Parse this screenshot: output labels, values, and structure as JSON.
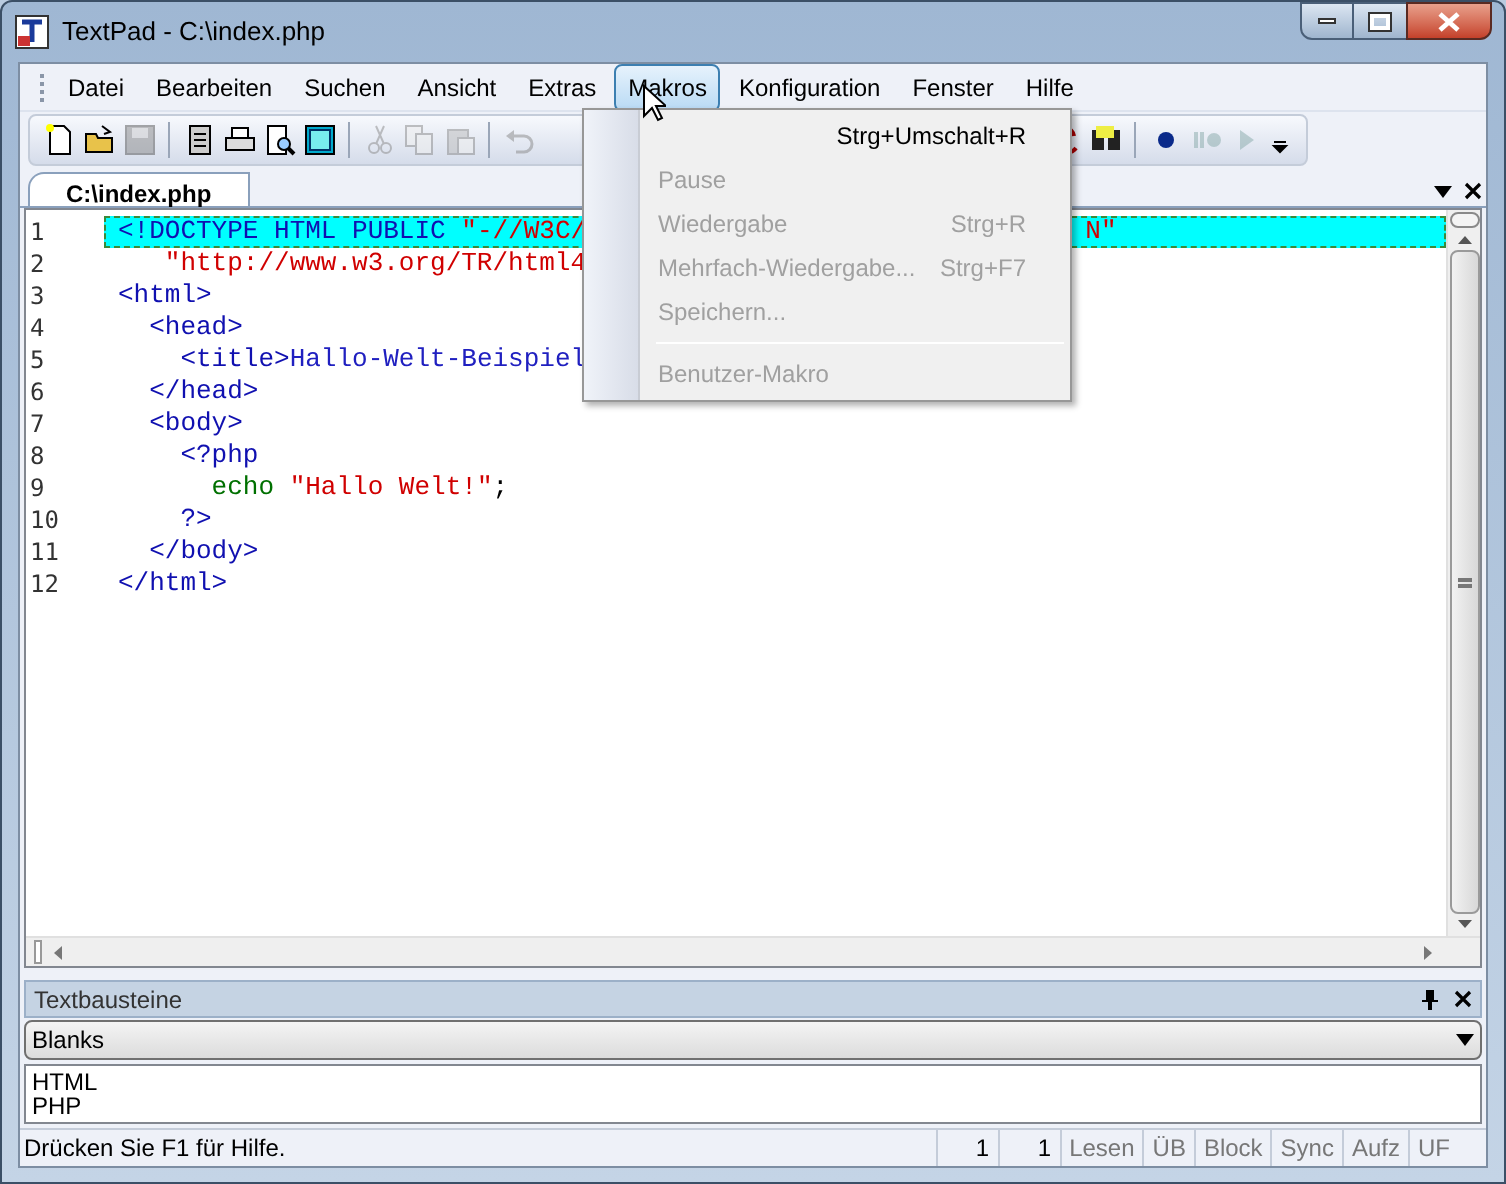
{
  "window": {
    "title": "TextPad - C:\\index.php"
  },
  "menu_bar": [
    {
      "label": "Datei",
      "selected": false
    },
    {
      "label": "Bearbeiten",
      "selected": false
    },
    {
      "label": "Suchen",
      "selected": false
    },
    {
      "label": "Ansicht",
      "selected": false
    },
    {
      "label": "Extras",
      "selected": false
    },
    {
      "label": "Makros",
      "selected": true
    },
    {
      "label": "Konfiguration",
      "selected": false
    },
    {
      "label": "Fenster",
      "selected": false
    },
    {
      "label": "Hilfe",
      "selected": false
    }
  ],
  "toolbar": [
    {
      "kind": "new",
      "disabled": false
    },
    {
      "kind": "open",
      "disabled": false
    },
    {
      "kind": "save",
      "disabled": true
    },
    {
      "kind": "sep"
    },
    {
      "kind": "docs",
      "disabled": false
    },
    {
      "kind": "print",
      "disabled": false
    },
    {
      "kind": "preview",
      "disabled": false
    },
    {
      "kind": "screen",
      "disabled": false
    },
    {
      "kind": "sep"
    },
    {
      "kind": "cut",
      "disabled": true
    },
    {
      "kind": "copy",
      "disabled": true
    },
    {
      "kind": "paste",
      "disabled": true
    },
    {
      "kind": "sep"
    },
    {
      "kind": "undo",
      "disabled": true
    },
    {
      "kind": "gap"
    },
    {
      "kind": "replace",
      "disabled": false
    },
    {
      "kind": "find",
      "disabled": false
    },
    {
      "kind": "sep"
    },
    {
      "kind": "record",
      "disabled": false
    },
    {
      "kind": "pause",
      "disabled": true
    },
    {
      "kind": "play",
      "disabled": true
    },
    {
      "kind": "more",
      "disabled": false
    }
  ],
  "document_tabs": [
    {
      "label": "C:\\index.php",
      "selected": true
    }
  ],
  "editor": {
    "lines": [
      {
        "number": "1",
        "selected": true,
        "tokens": [
          {
            "kind": "tag",
            "text": "<!DOCTYPE HTML PUBLIC "
          },
          {
            "kind": "string",
            "text": "\"-//W3C/"
          }
        ],
        "tail": [
          {
            "kind": "string",
            "text": "N\""
          }
        ]
      },
      {
        "number": "2",
        "selected": false,
        "tokens": [
          {
            "kind": "string",
            "text": "   \"http://www.w3.org/TR/html4"
          }
        ]
      },
      {
        "number": "3",
        "selected": false,
        "tokens": [
          {
            "kind": "tag",
            "text": "<html>"
          }
        ]
      },
      {
        "number": "4",
        "selected": false,
        "tokens": [
          {
            "kind": "tag",
            "text": "  <head>"
          }
        ]
      },
      {
        "number": "5",
        "selected": false,
        "tokens": [
          {
            "kind": "tag",
            "text": "    <title>"
          },
          {
            "kind": "content",
            "text": "Hallo-Welt-Beispiel"
          }
        ]
      },
      {
        "number": "6",
        "selected": false,
        "tokens": [
          {
            "kind": "tag",
            "text": "  </head>"
          }
        ]
      },
      {
        "number": "7",
        "selected": false,
        "tokens": [
          {
            "kind": "tag",
            "text": "  <body>"
          }
        ]
      },
      {
        "number": "8",
        "selected": false,
        "tokens": [
          {
            "kind": "tag",
            "text": "    <?php"
          }
        ]
      },
      {
        "number": "9",
        "selected": false,
        "tokens": [
          {
            "kind": "keyword",
            "text": "      echo "
          },
          {
            "kind": "string",
            "text": "\"Hallo Welt!\""
          },
          {
            "kind": "plain",
            "text": ";"
          }
        ]
      },
      {
        "number": "10",
        "selected": false,
        "tokens": [
          {
            "kind": "tag",
            "text": "    ?>"
          }
        ]
      },
      {
        "number": "11",
        "selected": false,
        "tokens": [
          {
            "kind": "tag",
            "text": "  </body>"
          }
        ]
      },
      {
        "number": "12",
        "selected": false,
        "tokens": [
          {
            "kind": "tag",
            "text": "</html>"
          }
        ]
      }
    ]
  },
  "dropdown_menu": [
    {
      "kind": "item",
      "shortcut": "Strg+Umschalt+R",
      "disabled": false
    },
    {
      "kind": "item",
      "label": "Pause",
      "disabled": true
    },
    {
      "kind": "item",
      "label": "Wiedergabe",
      "shortcut": "Strg+R",
      "disabled": true
    },
    {
      "kind": "item",
      "label": "Mehrfach-Wiedergabe...",
      "shortcut": "Strg+F7",
      "disabled": true
    },
    {
      "kind": "item",
      "label": "Speichern...",
      "disabled": true
    },
    {
      "kind": "separator"
    },
    {
      "kind": "item",
      "label": "Benutzer-Makro",
      "disabled": true
    }
  ],
  "clip_panel": {
    "title": "Textbausteine",
    "library": "Blanks",
    "items": [
      "HTML",
      "PHP"
    ]
  },
  "status_bar": {
    "message": "Drücken Sie F1 für Hilfe.",
    "fields": [
      {
        "text": "1",
        "disabled": false
      },
      {
        "text": "1",
        "disabled": false
      },
      {
        "text": "Lesen",
        "disabled": true
      },
      {
        "text": "ÜB",
        "disabled": true
      },
      {
        "text": "Block",
        "disabled": true
      },
      {
        "text": "Sync",
        "disabled": true
      },
      {
        "text": "Aufz",
        "disabled": true
      },
      {
        "text": "UF",
        "disabled": true
      }
    ]
  }
}
